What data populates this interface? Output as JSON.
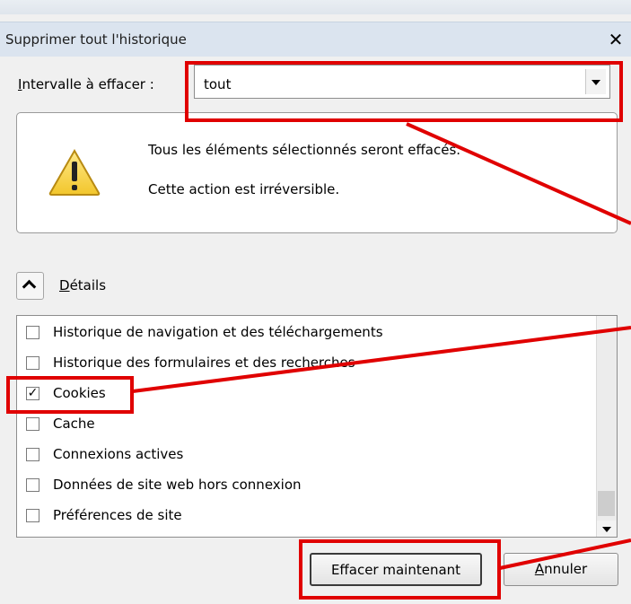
{
  "dialog": {
    "title": "Supprimer tout l'historique",
    "close_glyph": "✕"
  },
  "interval": {
    "label_mnemonic": "I",
    "label_rest": "ntervalle à effacer :",
    "selected": "tout"
  },
  "warning": {
    "icon": "warning-icon",
    "line1": "Tous les éléments sélectionnés seront effacés.",
    "line2": "Cette action est irréversible."
  },
  "details": {
    "toggle_icon": "chevron-up-icon",
    "label_mnemonic": "D",
    "label_rest": "étails",
    "items": [
      {
        "label": "Historique de navigation et des téléchargements",
        "checked": false
      },
      {
        "label": "Historique des formulaires et des recherches",
        "checked": false
      },
      {
        "label": "Cookies",
        "checked": true
      },
      {
        "label": "Cache",
        "checked": false
      },
      {
        "label": "Connexions actives",
        "checked": false
      },
      {
        "label": "Données de site web hors connexion",
        "checked": false
      },
      {
        "label": "Préférences de site",
        "checked": false
      }
    ]
  },
  "buttons": {
    "confirm_label": "Effacer maintenant",
    "cancel_mnemonic": "A",
    "cancel_rest": "nnuler"
  },
  "colors": {
    "annotation": "#e00000"
  }
}
